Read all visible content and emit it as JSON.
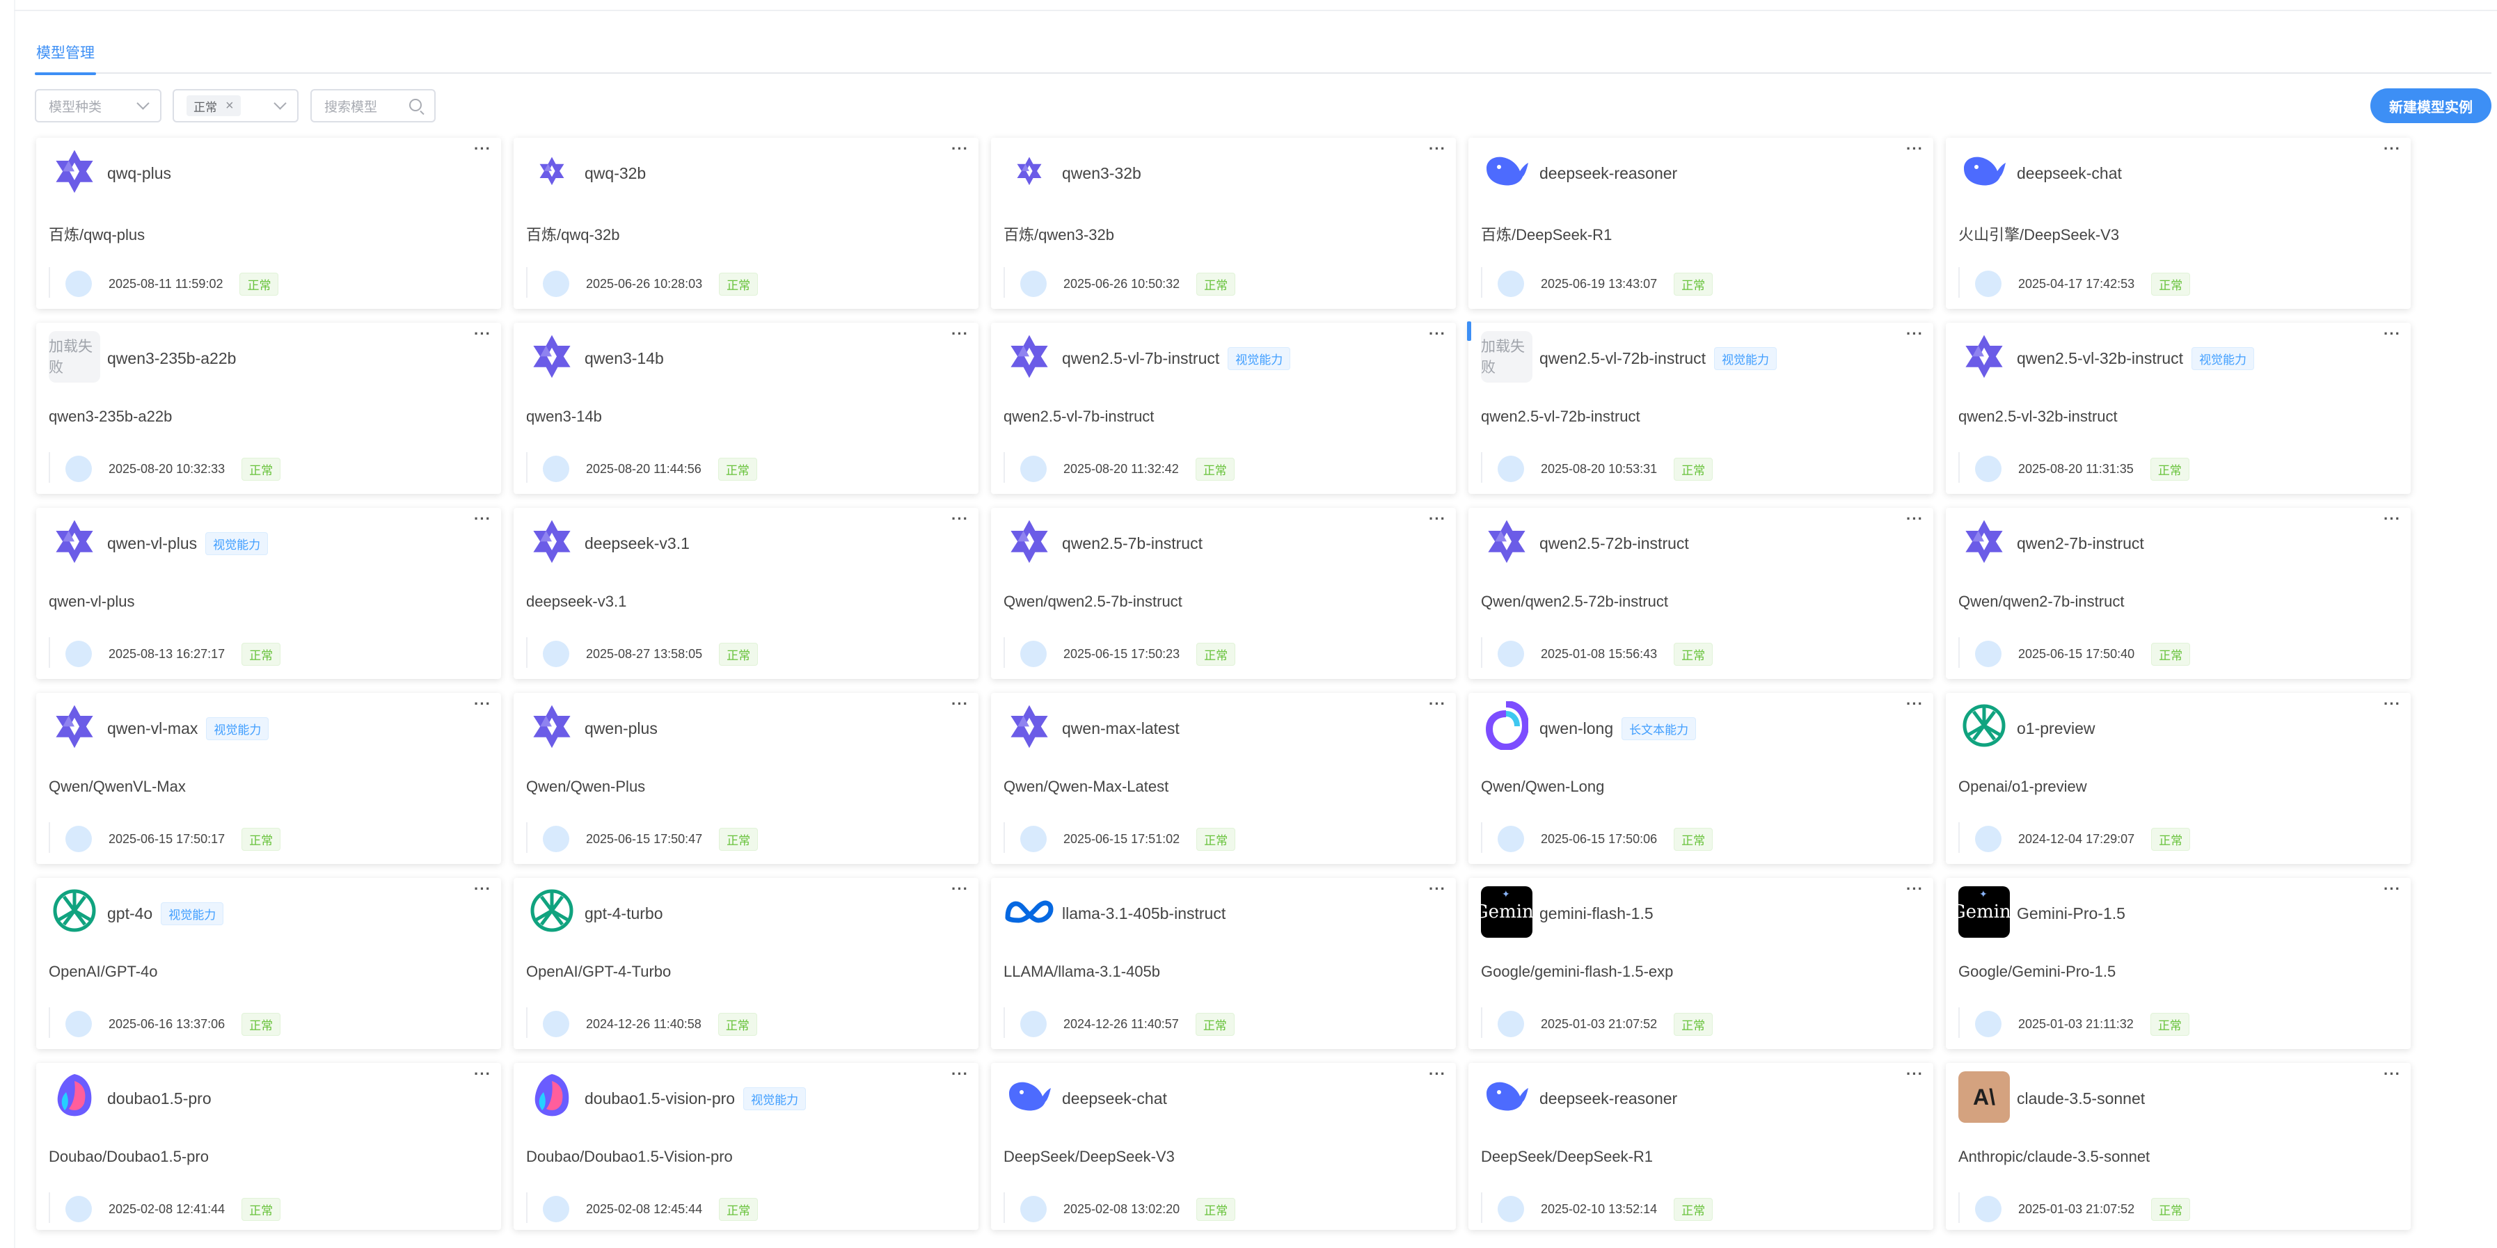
{
  "tabs": [
    {
      "label": "模型管理"
    }
  ],
  "filters": {
    "model_type_placeholder": "模型种类",
    "status_tag": "正常",
    "search_placeholder": "搜索模型"
  },
  "new_button_label": "新建模型实例",
  "fail_label": "加载失败",
  "colors": {
    "accent": "#3d8ff5",
    "status_green": "#67c23a",
    "badge_blue": "#409eff"
  },
  "cards": [
    {
      "name": "qwq-plus",
      "icon": "qwen",
      "path": "百炼/qwq-plus",
      "time": "2025-08-11 11:59:02",
      "status": "正常"
    },
    {
      "name": "qwq-32b",
      "icon": "qwen-small",
      "path": "百炼/qwq-32b",
      "time": "2025-06-26 10:28:03",
      "status": "正常"
    },
    {
      "name": "qwen3-32b",
      "icon": "qwen-small",
      "path": "百炼/qwen3-32b",
      "time": "2025-06-26 10:50:32",
      "status": "正常"
    },
    {
      "name": "deepseek-reasoner",
      "icon": "deepseek",
      "path": "百炼/DeepSeek-R1",
      "time": "2025-06-19 13:43:07",
      "status": "正常"
    },
    {
      "name": "deepseek-chat",
      "icon": "deepseek",
      "path": "火山引擎/DeepSeek-V3",
      "time": "2025-04-17 17:42:53",
      "status": "正常"
    },
    {
      "name": "qwen3-235b-a22b",
      "icon": "fail",
      "path": "qwen3-235b-a22b",
      "time": "2025-08-20 10:32:33",
      "status": "正常"
    },
    {
      "name": "qwen3-14b",
      "icon": "qwen",
      "path": "qwen3-14b",
      "time": "2025-08-20 11:44:56",
      "status": "正常"
    },
    {
      "name": "qwen2.5-vl-7b-instruct",
      "badge": "视觉能力",
      "icon": "qwen",
      "path": "qwen2.5-vl-7b-instruct",
      "time": "2025-08-20 11:32:42",
      "status": "正常"
    },
    {
      "name": "qwen2.5-vl-72b-instruct",
      "badge": "视觉能力",
      "icon": "fail",
      "accent": true,
      "path": "qwen2.5-vl-72b-instruct",
      "time": "2025-08-20 10:53:31",
      "status": "正常"
    },
    {
      "name": "qwen2.5-vl-32b-instruct",
      "badge": "视觉能力",
      "icon": "qwen",
      "path": "qwen2.5-vl-32b-instruct",
      "time": "2025-08-20 11:31:35",
      "status": "正常"
    },
    {
      "name": "qwen-vl-plus",
      "badge": "视觉能力",
      "icon": "qwen",
      "path": "qwen-vl-plus",
      "time": "2025-08-13 16:27:17",
      "status": "正常"
    },
    {
      "name": "deepseek-v3.1",
      "icon": "qwen",
      "path": "deepseek-v3.1",
      "time": "2025-08-27 13:58:05",
      "status": "正常"
    },
    {
      "name": "qwen2.5-7b-instruct",
      "icon": "qwen",
      "path": "Qwen/qwen2.5-7b-instruct",
      "time": "2025-06-15 17:50:23",
      "status": "正常"
    },
    {
      "name": "qwen2.5-72b-instruct",
      "icon": "qwen",
      "path": "Qwen/qwen2.5-72b-instruct",
      "time": "2025-01-08 15:56:43",
      "status": "正常"
    },
    {
      "name": "qwen2-7b-instruct",
      "icon": "qwen",
      "path": "Qwen/qwen2-7b-instruct",
      "time": "2025-06-15 17:50:40",
      "status": "正常"
    },
    {
      "name": "qwen-vl-max",
      "badge": "视觉能力",
      "icon": "qwen",
      "path": "Qwen/QwenVL-Max",
      "time": "2025-06-15 17:50:17",
      "status": "正常"
    },
    {
      "name": "qwen-plus",
      "icon": "qwen",
      "path": "Qwen/Qwen-Plus",
      "time": "2025-06-15 17:50:47",
      "status": "正常"
    },
    {
      "name": "qwen-max-latest",
      "icon": "qwen",
      "path": "Qwen/Qwen-Max-Latest",
      "time": "2025-06-15 17:51:02",
      "status": "正常"
    },
    {
      "name": "qwen-long",
      "badge": "长文本能力",
      "icon": "qwen-long",
      "path": "Qwen/Qwen-Long",
      "time": "2025-06-15 17:50:06",
      "status": "正常"
    },
    {
      "name": "o1-preview",
      "icon": "openai",
      "path": "Openai/o1-preview",
      "time": "2024-12-04 17:29:07",
      "status": "正常"
    },
    {
      "name": "gpt-4o",
      "badge": "视觉能力",
      "icon": "openai",
      "path": "OpenAI/GPT-4o",
      "time": "2025-06-16 13:37:06",
      "status": "正常"
    },
    {
      "name": "gpt-4-turbo",
      "icon": "openai",
      "path": "OpenAI/GPT-4-Turbo",
      "time": "2024-12-26 11:40:58",
      "status": "正常"
    },
    {
      "name": "llama-3.1-405b-instruct",
      "icon": "meta",
      "path": "LLAMA/llama-3.1-405b",
      "time": "2024-12-26 11:40:57",
      "status": "正常"
    },
    {
      "name": "gemini-flash-1.5",
      "icon": "gemini",
      "logo_text": "Gemini",
      "path": "Google/gemini-flash-1.5-exp",
      "time": "2025-01-03 21:07:52",
      "status": "正常"
    },
    {
      "name": "Gemini-Pro-1.5",
      "icon": "gemini",
      "logo_text": "Gemini",
      "path": "Google/Gemini-Pro-1.5",
      "time": "2025-01-03 21:11:32",
      "status": "正常"
    },
    {
      "name": "doubao1.5-pro",
      "icon": "doubao",
      "path": "Doubao/Doubao1.5-pro",
      "time": "2025-02-08 12:41:44",
      "status": "正常"
    },
    {
      "name": "doubao1.5-vision-pro",
      "badge": "视觉能力",
      "icon": "doubao",
      "path": "Doubao/Doubao1.5-Vision-pro",
      "time": "2025-02-08 12:45:44",
      "status": "正常"
    },
    {
      "name": "deepseek-chat",
      "icon": "deepseek",
      "path": "DeepSeek/DeepSeek-V3",
      "time": "2025-02-08 13:02:20",
      "status": "正常"
    },
    {
      "name": "deepseek-reasoner",
      "icon": "deepseek",
      "path": "DeepSeek/DeepSeek-R1",
      "time": "2025-02-10 13:52:14",
      "status": "正常"
    },
    {
      "name": "claude-3.5-sonnet",
      "icon": "claude",
      "logo_text": "A\\",
      "path": "Anthropic/claude-3.5-sonnet",
      "time": "2025-01-03 21:07:52",
      "status": "正常"
    }
  ]
}
